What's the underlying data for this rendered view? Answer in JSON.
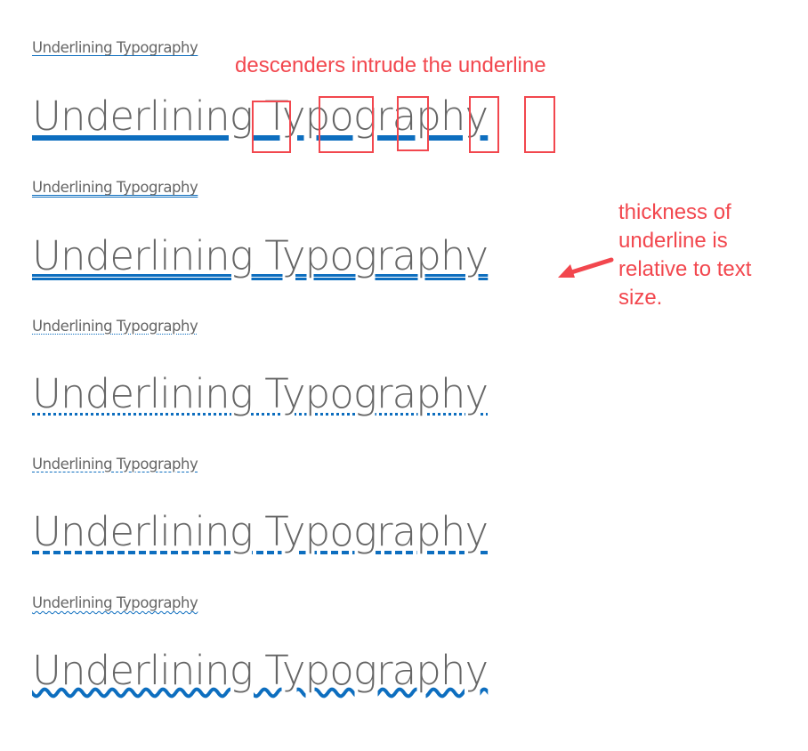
{
  "sample_text": "Underlining Typography",
  "underline_color": "#0d6ebf",
  "text_color": "#666666",
  "annotation_color": "#f2474e",
  "rows": [
    {
      "style": "solid",
      "small": "Underlining Typography",
      "large": "Underlining Typography"
    },
    {
      "style": "double",
      "small": "Underlining Typography",
      "large": "Underlining Typography"
    },
    {
      "style": "dotted",
      "small": "Underlining Typography",
      "large": "Underlining Typography"
    },
    {
      "style": "dashed",
      "small": "Underlining Typography",
      "large": "Underlining Typography"
    },
    {
      "style": "wavy",
      "small": "Underlining Typography",
      "large": "Underlining Typography"
    }
  ],
  "annotations": {
    "descenders": "descenders intrude the underline",
    "thickness_line1": "thickness of",
    "thickness_line2": "underline is",
    "thickness_line3": "relative to text",
    "thickness_line4": "size.",
    "arrow_icon": "arrow-left-icon",
    "highlighted_letters": [
      "g",
      "yp",
      "g",
      "p",
      "y"
    ]
  }
}
